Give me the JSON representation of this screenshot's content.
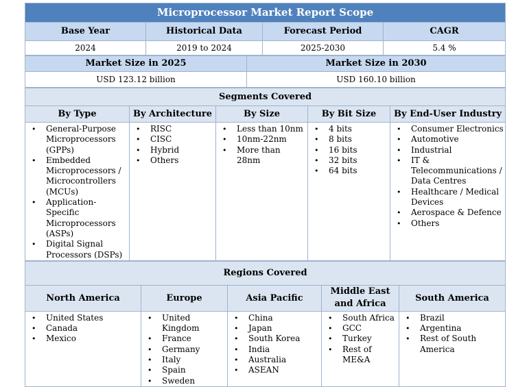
{
  "title": "Microprocessor Market Report Scope",
  "overview": {
    "headers": [
      "Base Year",
      "Historical Data",
      "Forecast Period",
      "CAGR"
    ],
    "values": [
      "2024",
      "2019 to 2024",
      "2025-2030",
      "5.4 %"
    ]
  },
  "market_size": {
    "headers": [
      "Market Size in 2025",
      "Market Size in 2030"
    ],
    "values": [
      "USD 123.12 billion",
      "USD 160.10 billion"
    ]
  },
  "segments": {
    "title": "Segments Covered",
    "columns": [
      {
        "header": "By Type",
        "items": [
          "General-Purpose Microprocessors (GPPs)",
          "Embedded Microprocessors / Microcontrollers (MCUs)",
          "Application-Specific Microprocessors (ASPs)",
          "Digital Signal Processors (DSPs)"
        ]
      },
      {
        "header": "By Architecture",
        "items": [
          "RISC",
          "CISC",
          "Hybrid",
          "Others"
        ]
      },
      {
        "header": "By Size",
        "items": [
          "Less than 10nm",
          "10nm-22nm",
          "More than 28nm"
        ]
      },
      {
        "header": "By Bit Size",
        "items": [
          "4 bits",
          "8 bits",
          "16 bits",
          "32 bits",
          "64 bits"
        ]
      },
      {
        "header": "By End-User Industry",
        "items": [
          "Consumer Electronics",
          "Automotive",
          "Industrial",
          "IT & Telecommunications / Data Centres",
          "Healthcare / Medical Devices",
          "Aerospace & Defence",
          "Others"
        ]
      }
    ]
  },
  "regions": {
    "title": "Regions Covered",
    "columns": [
      {
        "header": "North America",
        "items": [
          "United States",
          "Canada",
          "Mexico"
        ]
      },
      {
        "header": "Europe",
        "items": [
          "United Kingdom",
          "France",
          "Germany",
          "Italy",
          "Spain",
          "Sweden"
        ]
      },
      {
        "header": "Asia Pacific",
        "items": [
          "China",
          "Japan",
          "South Korea",
          "India",
          "Australia",
          "ASEAN"
        ]
      },
      {
        "header": "Middle East and Africa",
        "items": [
          "South Africa",
          "GCC",
          "Turkey",
          "Rest of ME&A"
        ]
      },
      {
        "header": "South America",
        "items": [
          "Brazil",
          "Argentina",
          "Rest of South America"
        ]
      }
    ]
  },
  "bullet_icon": "bullet-dot-icon",
  "colors": {
    "title_bg": "#4f81bd",
    "header_bg": "#c6d9f1",
    "section_bg": "#dbe5f1",
    "border": "#9fb3cc"
  }
}
